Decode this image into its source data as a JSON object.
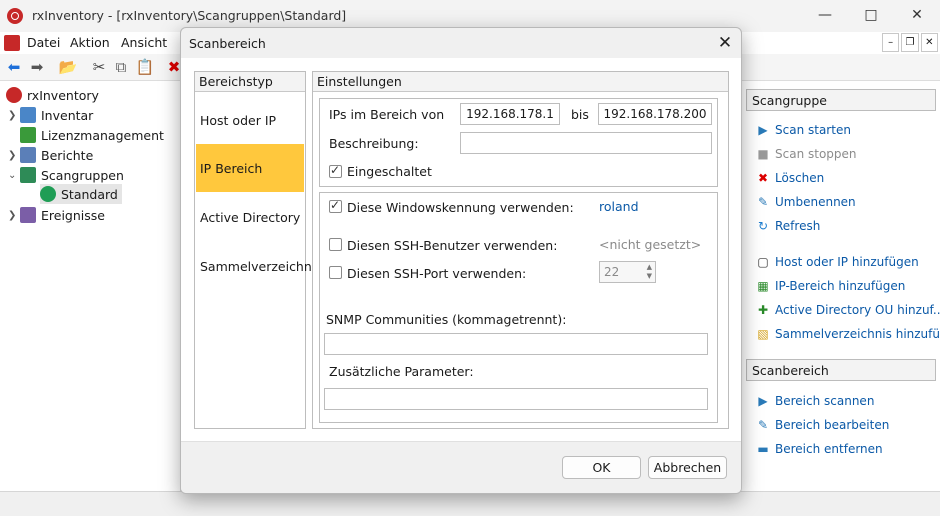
{
  "window": {
    "title": "rxInventory - [rxInventory\\Scangruppen\\Standard]"
  },
  "menu": [
    "Datei",
    "Aktion",
    "Ansicht"
  ],
  "tree": {
    "root": "rxInventory",
    "items": [
      "Inventar",
      "Lizenzmanagement",
      "Berichte",
      "Scangruppen"
    ],
    "child": "Standard",
    "last": "Ereignisse"
  },
  "actions": {
    "group1_title": "Scangruppe",
    "group1": [
      "Scan starten",
      "Scan stoppen",
      "Löschen",
      "Umbenennen",
      "Refresh"
    ],
    "group1b": [
      "Host oder IP hinzufügen",
      "IP-Bereich hinzufügen",
      "Active Directory OU hinzuf...",
      "Sammelverzeichnis hinzufü..."
    ],
    "group2_title": "Scanbereich",
    "group2": [
      "Bereich scannen",
      "Bereich bearbeiten",
      "Bereich entfernen"
    ]
  },
  "dialog": {
    "title": "Scanbereich",
    "types_title": "Bereichstyp",
    "types": [
      "Host oder IP",
      "IP Bereich",
      "Active Directory",
      "Sammelverzeichnis"
    ],
    "settings_title": "Einstellungen",
    "ip_label": "IPs im Bereich von",
    "ip_from": "192.168.178.1",
    "bis": "bis",
    "ip_to": "192.168.178.200",
    "desc_label": "Beschreibung:",
    "desc_value": "",
    "enabled_label": "Eingeschaltet",
    "win_label": "Diese Windowskennung verwenden:",
    "win_value": "roland",
    "ssh_user_label": "Diesen SSH-Benutzer verwenden:",
    "ssh_user_value": "<nicht gesetzt>",
    "ssh_port_label": "Diesen SSH-Port verwenden:",
    "ssh_port_value": "22",
    "snmp_label": "SNMP Communities (kommagetrennt):",
    "snmp_value": "",
    "params_label": "Zusätzliche Parameter:",
    "params_value": "",
    "ok": "OK",
    "cancel": "Abbrechen"
  }
}
